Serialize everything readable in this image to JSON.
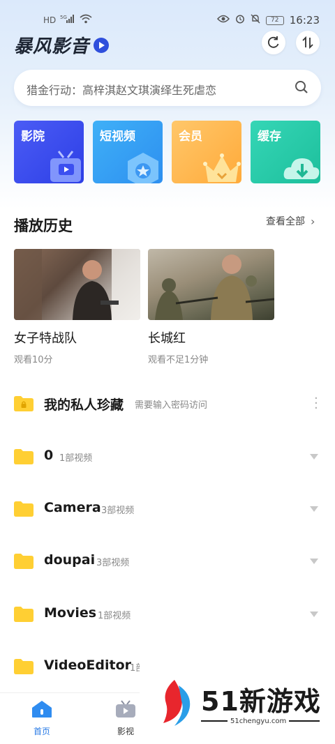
{
  "status_bar": {
    "left_icons": [
      "HD",
      "5G",
      "signal",
      "wifi"
    ],
    "right_icons": [
      "eye-icon",
      "alarm-icon",
      "mute-icon"
    ],
    "battery": "72",
    "time": "16:23"
  },
  "header": {
    "brand": "暴风影音",
    "refresh_icon": "refresh-icon",
    "sort_icon": "sort-icon"
  },
  "search": {
    "placeholder": "猎金行动：高梓淇赵文琪演绎生死虐恋"
  },
  "categories": [
    {
      "label": "影院",
      "icon": "tv-icon",
      "color": "#3c4ff0"
    },
    {
      "label": "短视频",
      "icon": "star-hexagon-icon",
      "color": "#36a2f5"
    },
    {
      "label": "会员",
      "icon": "crown-icon",
      "color": "#ffb84f"
    },
    {
      "label": "缓存",
      "icon": "cloud-download-icon",
      "color": "#27cba8"
    }
  ],
  "history": {
    "title": "播放历史",
    "view_all": "查看全部",
    "items": [
      {
        "title": "女子特战队",
        "progress": "观看10分"
      },
      {
        "title": "长城红",
        "progress": "观看不足1分钟"
      }
    ]
  },
  "folders": [
    {
      "name": "我的私人珍藏",
      "count": "需要输入密码访问",
      "locked": true
    },
    {
      "name": "0",
      "count": "1部视频"
    },
    {
      "name": "Camera",
      "count": "3部视频"
    },
    {
      "name": "doupai",
      "count": "3部视频"
    },
    {
      "name": "Movies",
      "count": "1部视频"
    },
    {
      "name": "VideoEditor",
      "count": "1部视频"
    }
  ],
  "bottom_nav": [
    {
      "label": "首页",
      "active": true
    },
    {
      "label": "影视",
      "active": false
    }
  ],
  "watermark": {
    "text": "51新游戏",
    "url": "51chengyu.com"
  }
}
